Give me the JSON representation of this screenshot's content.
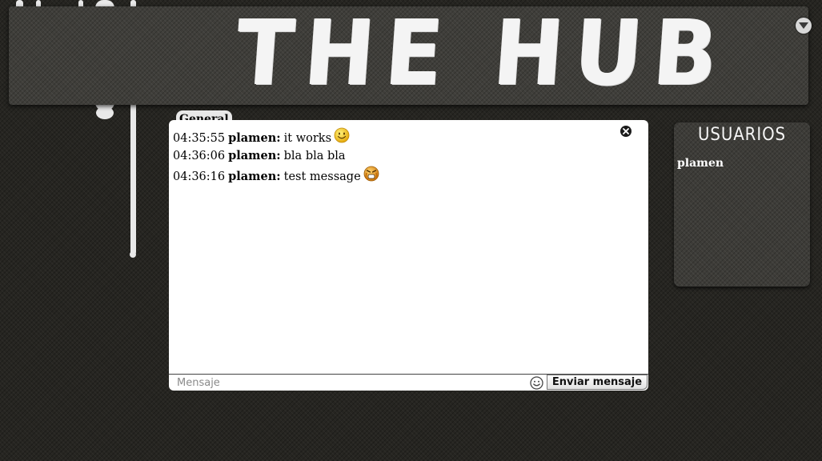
{
  "header": {
    "logo_text": "THE HUB",
    "collapse_icon": "chevron-down-icon"
  },
  "chat": {
    "tab_label": "General",
    "close_icon": "close-icon",
    "messages": [
      {
        "time": "04:35:55",
        "user": "plamen:",
        "text": "it works",
        "emoji": "smiley-emoji"
      },
      {
        "time": "04:36:06",
        "user": "plamen:",
        "text": "bla bla bla",
        "emoji": ""
      },
      {
        "time": "04:36:16",
        "user": "plamen:",
        "text": "test message",
        "emoji": "angry-emoji"
      }
    ],
    "input": {
      "placeholder": "Mensaje",
      "value": ""
    },
    "emoji_picker_icon": "smiley-icon",
    "send_label": "Enviar mensaje"
  },
  "users": {
    "title": "USUARIOS",
    "list": [
      "plamen"
    ]
  },
  "colors": {
    "background": "#262521",
    "panel": "#3f3e3a",
    "chat_bg": "#ffffff",
    "text_light": "#ffffff"
  }
}
